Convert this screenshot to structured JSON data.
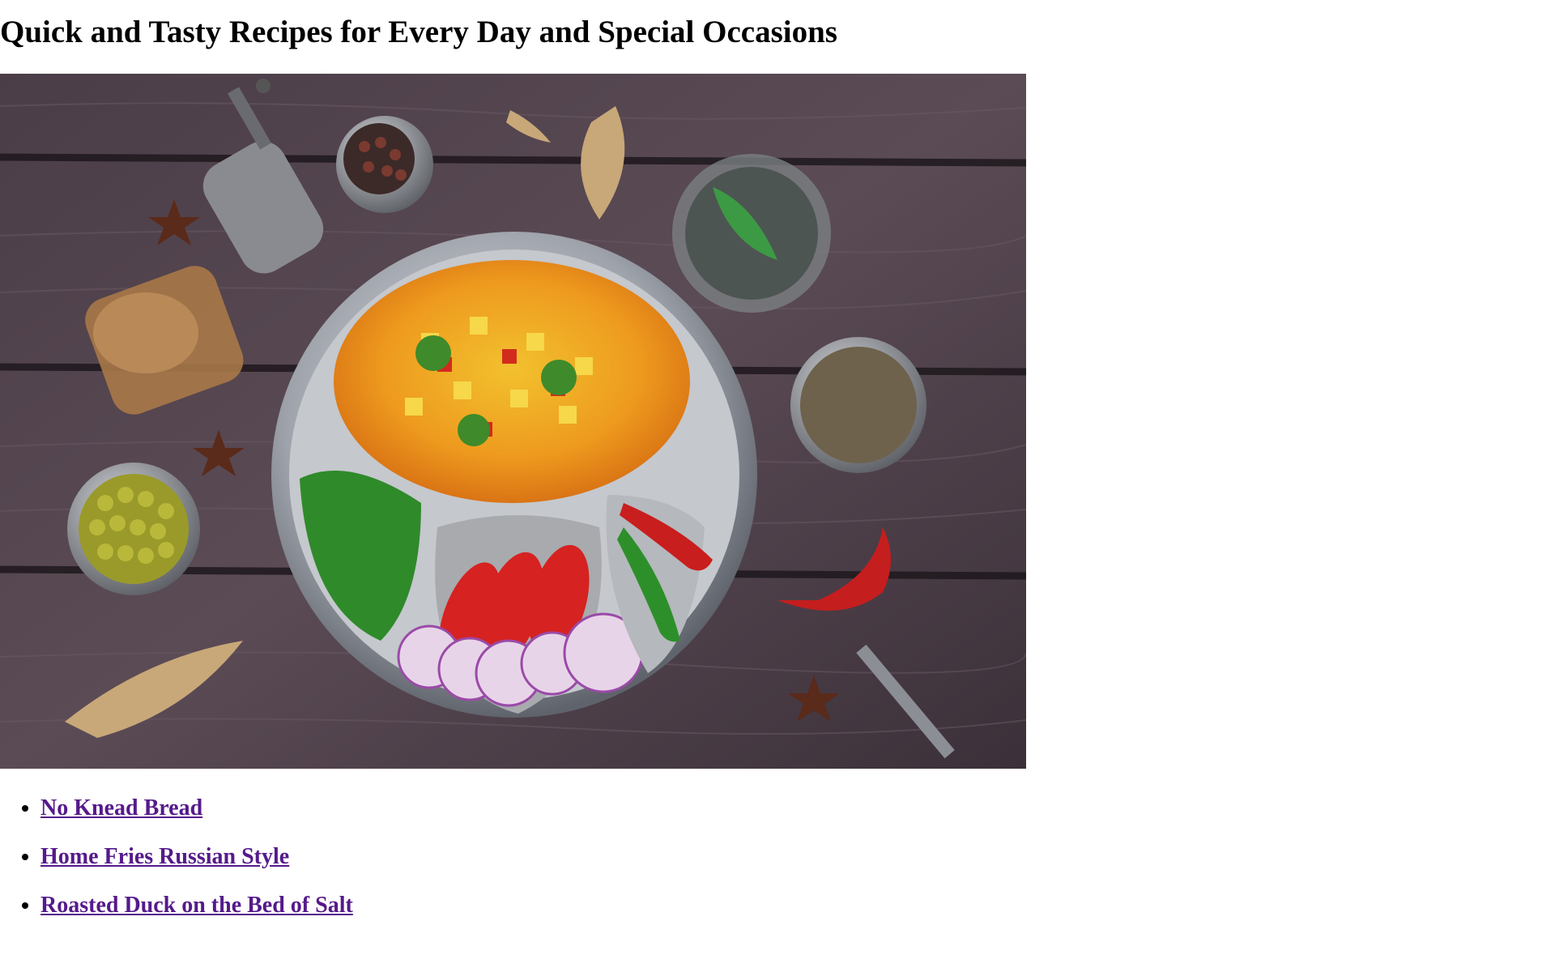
{
  "page": {
    "title": "Quick and Tasty Recipes for Every Day and Special Occasions"
  },
  "hero": {
    "alt": "Vegetable curry on a steel thali plate with spices on a wooden table"
  },
  "recipes": [
    {
      "label": "No Knead Bread"
    },
    {
      "label": "Home Fries Russian Style"
    },
    {
      "label": "Roasted Duck on the Bed of Salt"
    }
  ],
  "colors": {
    "link_visited": "#551a8b",
    "wood_dark": "#3a2f38",
    "plate_steel": "#b9bcc2",
    "curry_orange": "#e7901b"
  }
}
